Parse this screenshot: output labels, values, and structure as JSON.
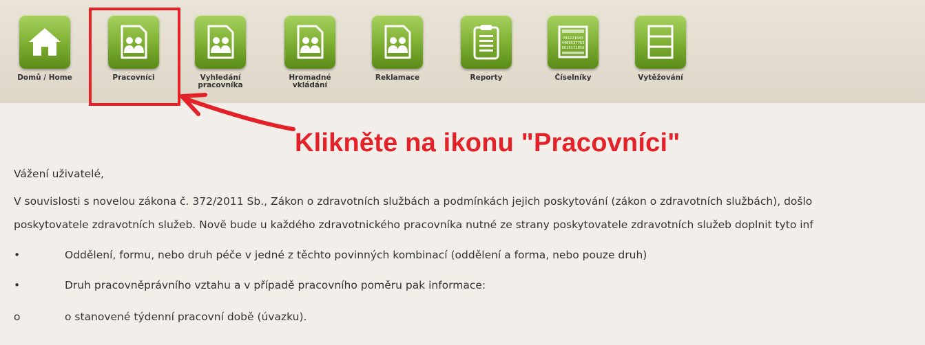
{
  "toolbar": {
    "items": [
      {
        "label": "Domů / Home",
        "icon": "home-icon"
      },
      {
        "label": "Pracovníci",
        "icon": "users-document-icon"
      },
      {
        "label": "Vyhledání pracovníka",
        "icon": "users-document-icon"
      },
      {
        "label": "Hromadné vkládání",
        "icon": "users-document-icon"
      },
      {
        "label": "Reklamace",
        "icon": "users-document-icon"
      },
      {
        "label": "Reporty",
        "icon": "clipboard-icon"
      },
      {
        "label": "Číselníky",
        "icon": "number-list-icon"
      },
      {
        "label": "Vytěžování",
        "icon": "drawer-icon"
      }
    ],
    "number_list_icon_text": [
      "781221643",
      "4409537763",
      "8610172856"
    ]
  },
  "annotation": {
    "text": "Klikněte na ikonu \"Pracovníci\"",
    "color": "#e22228"
  },
  "content": {
    "greeting": "Vážení uživatelé,",
    "paragraph_line1": "V souvislosti s novelou zákona č. 372/2011 Sb., Zákon o zdravotních službách a podmínkách jejich poskytování (zákon o zdravotních službách), došlo",
    "paragraph_line2": "poskytovatele zdravotních služeb. Nově bude u každého zdravotnického pracovníka nutné ze strany poskytovatele zdravotních služeb doplnit tyto inf",
    "bullets": [
      {
        "marker": "•",
        "text": "Oddělení, formu, nebo druh péče v jedné z těchto povinných kombinací (oddělení a forma, nebo pouze druh)"
      },
      {
        "marker": "•",
        "text": "Druh pracovněprávního vztahu a v případě pracovního poměru pak informace:"
      },
      {
        "marker": "o",
        "text": "o stanovené týdenní pracovní době (úvazku)."
      }
    ]
  },
  "colors": {
    "tile_green": "#7dad31",
    "highlight_red": "#e52227",
    "background": "#f2eeea"
  }
}
